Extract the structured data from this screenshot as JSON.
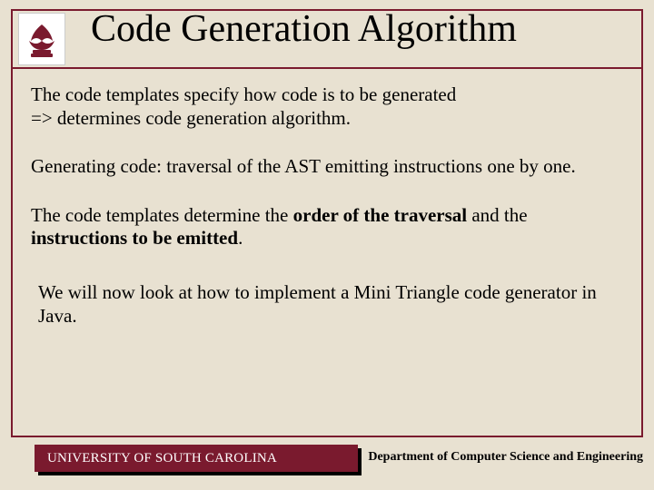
{
  "title": "Code Generation Algorithm",
  "para1_line1": "The code templates specify how code is to be generated",
  "para1_line2": "=> determines code generation algorithm.",
  "para2": "Generating code: traversal of the AST emitting instructions one by one.",
  "para3_a": "The code templates determine the ",
  "para3_b": "order of the traversal",
  "para3_c": " and the ",
  "para3_d": "instructions to be emitted",
  "para3_e": ".",
  "para4": "We will now look at how to implement a Mini Triangle code generator in Java.",
  "footer_left": "UNIVERSITY OF SOUTH CAROLINA",
  "footer_right": "Department of Computer Science and Engineering"
}
